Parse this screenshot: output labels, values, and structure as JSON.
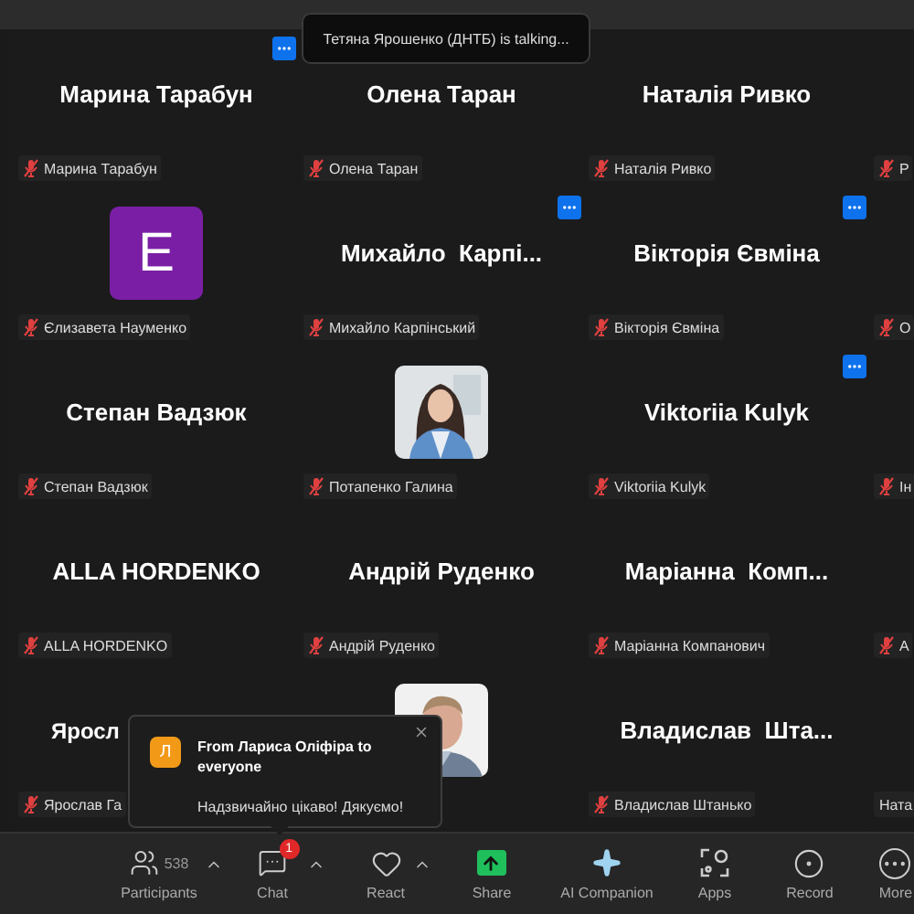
{
  "speaking_toast": {
    "text": "Тетяна Ярошенко (ДНТБ) is talking..."
  },
  "tiles": [
    {
      "kind": "name",
      "name": "Марина Тарабун",
      "tag": "Марина Тарабун",
      "muted": true,
      "menu": true
    },
    {
      "kind": "name",
      "name": "Олена Таран",
      "tag": "Олена Таран",
      "muted": true,
      "menu": false
    },
    {
      "kind": "name",
      "name": "Наталія Ривко",
      "tag": "Наталія Ривко",
      "muted": true,
      "menu": false
    },
    {
      "kind": "blank",
      "tag": "Р",
      "muted": true
    },
    {
      "kind": "letter",
      "letter": "E",
      "tag": "Єлизавета Науменко",
      "muted": true,
      "menu": false
    },
    {
      "kind": "name",
      "name": "Михайло  Карпі...",
      "tag": "Михайло Карпінський",
      "muted": true,
      "menu": true
    },
    {
      "kind": "name",
      "name": "Вікторія Євміна",
      "tag": "Вікторія Євміна",
      "muted": true,
      "menu": true
    },
    {
      "kind": "blank",
      "tag": "О",
      "muted": true
    },
    {
      "kind": "name",
      "name": "Степан Вадзюк",
      "tag": "Степан Вадзюк",
      "muted": true,
      "menu": false
    },
    {
      "kind": "picture",
      "tag": "Потапенко Галина",
      "muted": true,
      "menu": false
    },
    {
      "kind": "name",
      "name": "Viktoriia Kulyk",
      "tag": "Viktoriia Kulyk",
      "muted": true,
      "menu": true
    },
    {
      "kind": "blank",
      "tag": "Ін",
      "muted": true
    },
    {
      "kind": "name",
      "name": "ALLA HORDENKO",
      "tag": "ALLA HORDENKO",
      "muted": true,
      "menu": false
    },
    {
      "kind": "name",
      "name": "Андрій Руденко",
      "tag": "Андрій Руденко",
      "muted": true,
      "menu": false
    },
    {
      "kind": "name",
      "name": "Маріанна  Комп...",
      "tag": "Маріанна Компанович",
      "muted": true,
      "menu": false
    },
    {
      "kind": "blank",
      "tag": "А",
      "muted": true
    },
    {
      "kind": "name",
      "name": "Яросл",
      "tag": "Ярослав Га",
      "muted": true,
      "menu": false,
      "covered": true
    },
    {
      "kind": "picture",
      "menu": false
    },
    {
      "kind": "name",
      "name": "Владислав  Шта...",
      "tag": "Владислав Штанько",
      "muted": true,
      "menu": false
    },
    {
      "kind": "blank",
      "tag": "Ната",
      "muted": false
    }
  ],
  "chat_popup": {
    "avatar_letter": "Л",
    "title": "From Лариса Оліфіра to everyone",
    "message": "Надзвичайно цікаво! Дякуємо!"
  },
  "toolbar": [
    {
      "kind": "participants",
      "label": "Participants",
      "count": "538",
      "caret": true
    },
    {
      "kind": "chat",
      "label": "Chat",
      "badge": "1",
      "caret": true
    },
    {
      "kind": "react",
      "label": "React",
      "caret": true
    },
    {
      "kind": "share",
      "label": "Share"
    },
    {
      "kind": "ai",
      "label": "AI Companion"
    },
    {
      "kind": "apps",
      "label": "Apps"
    },
    {
      "kind": "record",
      "label": "Record"
    },
    {
      "kind": "more",
      "label": "More"
    }
  ]
}
